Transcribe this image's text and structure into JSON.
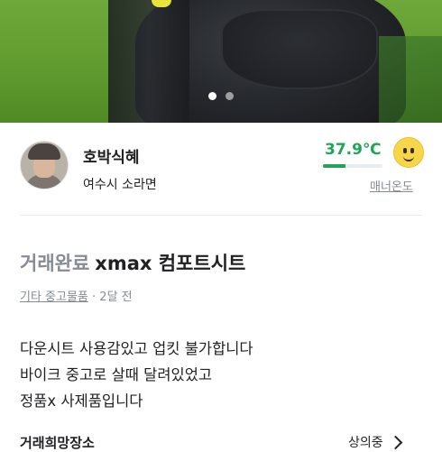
{
  "photo": {
    "page_index": 0,
    "page_count": 2
  },
  "seller": {
    "nickname": "호박식혜",
    "region": "여수시 소라면",
    "manner_temp": "37.9℃",
    "manner_temp_value": 37.9,
    "manner_label": "매너온도",
    "accent": "#1fa45a"
  },
  "post": {
    "status": "거래완료",
    "title": "xmax 컴포트시트",
    "category": "기타 중고물품",
    "time": " · 2달 전",
    "description_lines": [
      "다운시트 사용감있고 업킷 불가합니다",
      "바이크 중고로 살때 달려있었고",
      "정품x 사제품입니다"
    ],
    "cut_left": "거래희망장소",
    "cut_right": "상의중"
  }
}
